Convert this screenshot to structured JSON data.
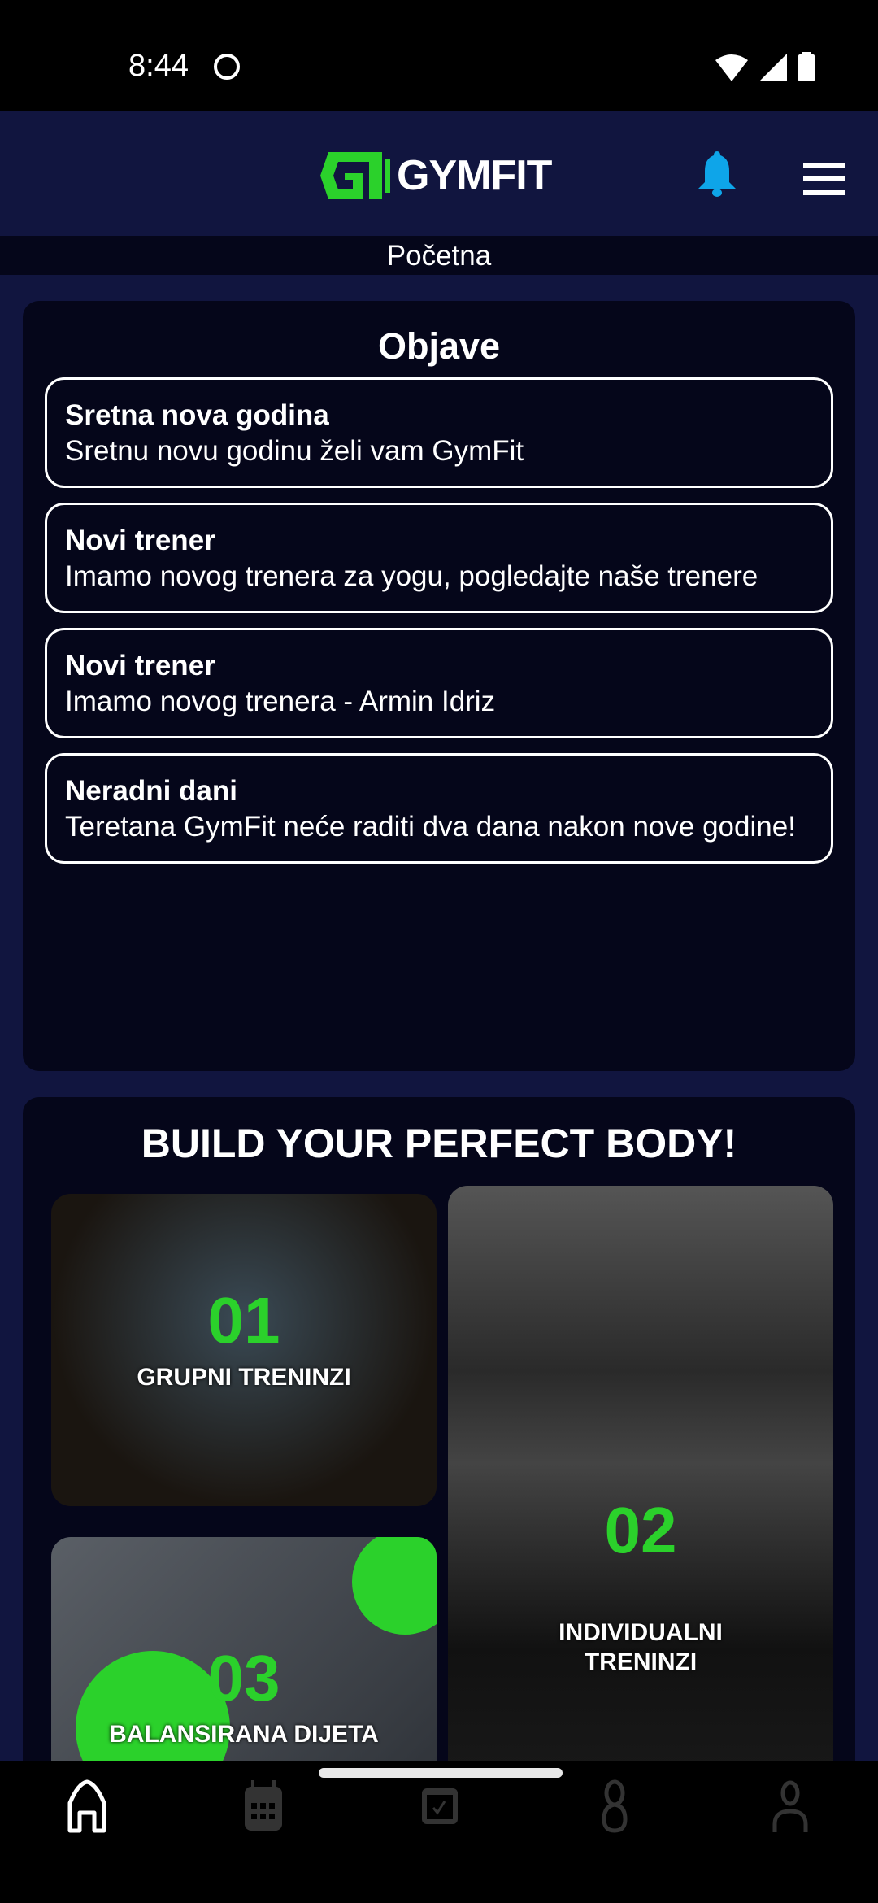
{
  "status_bar": {
    "time": "8:44"
  },
  "header": {
    "logo_text": "GYMFIT",
    "page_title": "Početna"
  },
  "announcements": {
    "title": "Objave",
    "items": [
      {
        "title": "Sretna nova godina",
        "body": "Sretnu novu godinu želi vam GymFit"
      },
      {
        "title": "Novi trener",
        "body": "Imamo novog trenera za yogu, pogledajte naše trenere"
      },
      {
        "title": "Novi trener",
        "body": "Imamo novog trenera - Armin Idriz"
      },
      {
        "title": "Neradni dani",
        "body": "Teretana GymFit neće raditi dva dana nakon nove godine!"
      }
    ]
  },
  "promo": {
    "title": "BUILD YOUR PERFECT BODY!",
    "tiles": [
      {
        "number": "01",
        "label": "GRUPNI TRENINZI"
      },
      {
        "number": "02",
        "label": "INDIVIDUALNI TRENINZI"
      },
      {
        "number": "03",
        "label": "BALANSIRANA DIJETA"
      }
    ]
  },
  "colors": {
    "accent": "#2bd12b",
    "bell": "#0ea5e9",
    "background": "#11153f",
    "card": "#05061a"
  }
}
